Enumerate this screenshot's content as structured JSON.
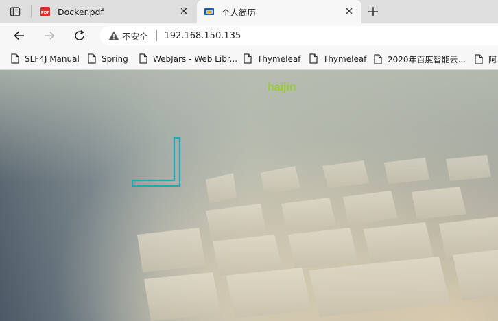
{
  "tabs": [
    {
      "title": "Docker.pdf",
      "favicon": "pdf-icon",
      "active": false
    },
    {
      "title": "个人简历",
      "favicon": "site-icon",
      "active": true
    }
  ],
  "address_bar": {
    "security_text": "不安全",
    "url": "192.168.150.135"
  },
  "bookmarks": [
    {
      "label": "SLF4J Manual"
    },
    {
      "label": "Spring"
    },
    {
      "label": "WebJars - Web Libr..."
    },
    {
      "label": "Thymeleaf"
    },
    {
      "label": "Thymeleaf"
    },
    {
      "label": "2020年百度智能云..."
    },
    {
      "label": "阿"
    }
  ],
  "page": {
    "title": "haijin",
    "title_color": "#9acd32",
    "accent_color": "#22a7b8"
  }
}
